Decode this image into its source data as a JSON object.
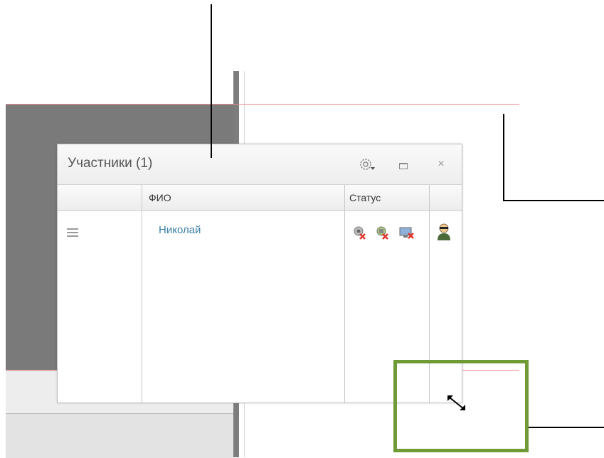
{
  "window": {
    "title": "Участники (1)",
    "close_glyph": "×",
    "icons": [
      "settings-gear-icon",
      "maximize-icon",
      "close-icon",
      "drag-handle-icon",
      "user-agent-icon",
      "resize-diagonal-icon"
    ]
  },
  "table": {
    "columns": [
      {
        "label": ""
      },
      {
        "label": "ФИО"
      },
      {
        "label": "Статус"
      },
      {
        "label": ""
      }
    ],
    "rows": [
      {
        "name": "Николай",
        "status_icons": [
          "camera-disabled-icon",
          "microphone-disabled-icon",
          "screen-share-disabled-icon"
        ],
        "role_icon": "user-agent-icon"
      }
    ]
  },
  "colors": {
    "highlight": "#6f9a35",
    "guide_lines": "#ec8c8c",
    "name_link": "#3a7fa8",
    "disabled_mark": "#e0332a"
  }
}
